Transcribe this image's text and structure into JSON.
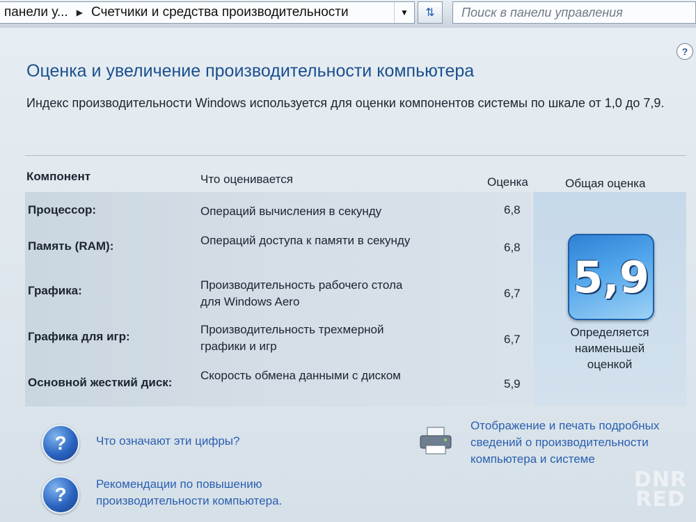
{
  "address_bar": {
    "breadcrumb_parent": "панели у...",
    "breadcrumb_current": "Счетчики и средства производительности",
    "search_placeholder": "Поиск в панели управления"
  },
  "page": {
    "title": "Оценка и увеличение производительности компьютера",
    "description": "Индекс производительности Windows используется для оценки компонентов системы по шкале от 1,0 до 7,9."
  },
  "table": {
    "headers": {
      "component": "Компонент",
      "what": "Что оценивается",
      "score": "Оценка",
      "overall": "Общая оценка"
    },
    "rows": [
      {
        "component": "Процессор:",
        "what": "Операций вычисления в секунду",
        "score": "6,8"
      },
      {
        "component": "Память (RAM):",
        "what": "Операций доступа к памяти в секунду",
        "score": "6,8"
      },
      {
        "component": "Графика:",
        "what": "Производительность рабочего стола для Windows Aero",
        "score": "6,7"
      },
      {
        "component": "Графика для игр:",
        "what": "Производительность трехмерной графики и игр",
        "score": "6,7"
      },
      {
        "component": "Основной жесткий диск:",
        "what": "Скорость обмена данными с диском",
        "score": "5,9"
      }
    ]
  },
  "overall": {
    "score": "5,9",
    "caption": "Определяется наименьшей оценкой"
  },
  "links": {
    "what_numbers": "Что означают эти цифры?",
    "recommendations": "Рекомендации по повышению производительности компьютера.",
    "print_details": "Отображение и печать подробных сведений о производительности компьютера и системе"
  },
  "watermark": "DNR RED",
  "icons": {
    "help": "question-circle",
    "printer": "printer",
    "refresh": "refresh-arrows"
  },
  "colors": {
    "title": "#1a4f8f",
    "link": "#2a5fb0",
    "badge": "#2e7fd3"
  }
}
